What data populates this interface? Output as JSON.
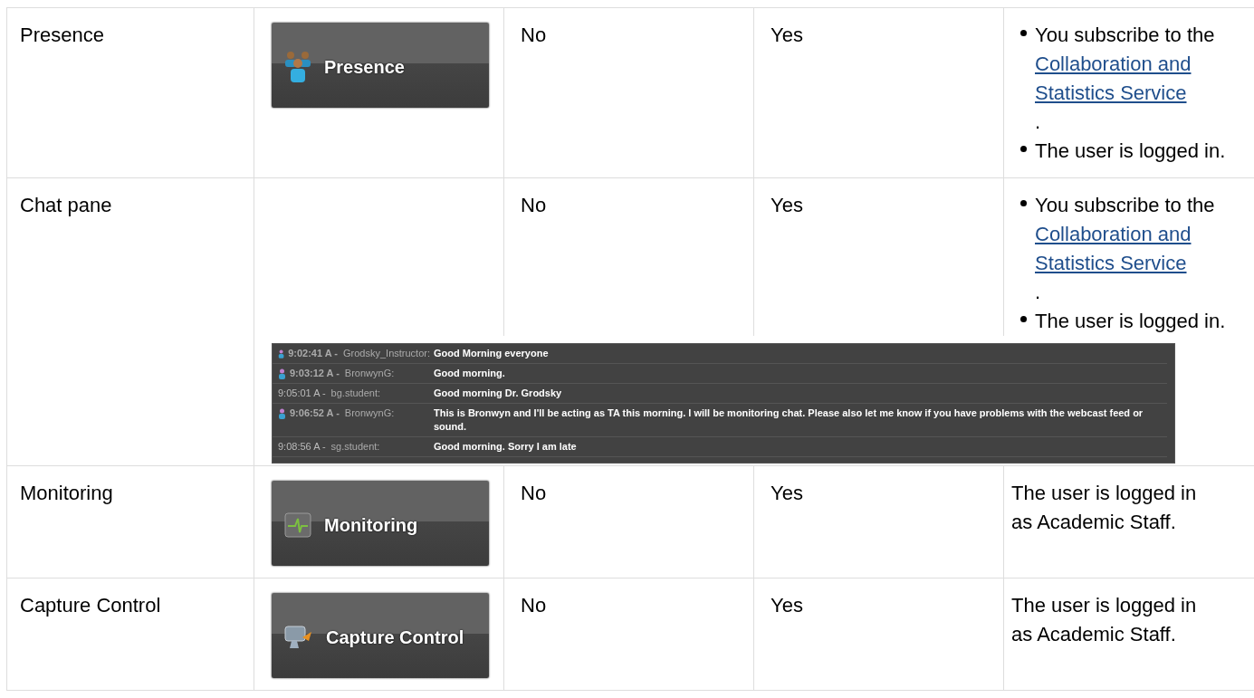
{
  "rows": [
    {
      "feature": "Presence",
      "image": {
        "kind": "toolbar",
        "label": "Presence"
      },
      "column_3": "No",
      "column_4": "Yes",
      "requirements": {
        "kind": "list",
        "items": [
          {
            "text": "You subscribe to the ",
            "link": "Collaboration and Statistics Service",
            "after": "."
          },
          {
            "text": "The user is logged in."
          }
        ]
      }
    },
    {
      "feature": "Chat pane",
      "image": {
        "kind": "chat",
        "messages": [
          {
            "time": "9:02:41 A -",
            "sender": "Grodsky_Instructor:",
            "text": "Good Morning everyone",
            "icon": true
          },
          {
            "time": "9:03:12 A -",
            "sender": "BronwynG:",
            "text": "Good morning.",
            "icon": true
          },
          {
            "time": "9:05:01 A -",
            "sender": "bg.student:",
            "text": "Good morning Dr. Grodsky",
            "icon": false
          },
          {
            "time": "9:06:52 A -",
            "sender": "BronwynG:",
            "text": "This is Bronwyn and I'll be acting as TA this morning. I will be monitoring chat. Please also let me know if you have problems with the webcast feed or sound.",
            "icon": true
          },
          {
            "time": "9:08:56 A -",
            "sender": "sg.student:",
            "text": "Good morning. Sorry I am late",
            "icon": false
          }
        ]
      },
      "column_3": "No",
      "column_4": "Yes",
      "requirements": {
        "kind": "list",
        "items": [
          {
            "text": "You subscribe to the ",
            "link": "Collaboration and Statistics Service",
            "after": "."
          },
          {
            "text": "The user is logged in."
          }
        ]
      }
    },
    {
      "feature": "Monitoring",
      "image": {
        "kind": "toolbar",
        "label": "Monitoring"
      },
      "column_3": "No",
      "column_4": "Yes",
      "requirements": {
        "kind": "text",
        "text": "The user is logged in as Academic Staff."
      }
    },
    {
      "feature": "Capture Control",
      "image": {
        "kind": "toolbar",
        "label": "Capture Control"
      },
      "column_3": "No",
      "column_4": "Yes",
      "requirements": {
        "kind": "text",
        "text": "The user is logged in as Academic Staff."
      }
    }
  ]
}
